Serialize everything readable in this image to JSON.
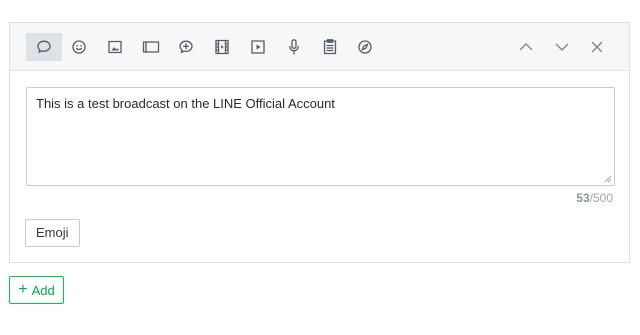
{
  "toolbar": {
    "tools": [
      {
        "icon": "speech-bubble-icon",
        "active": true
      },
      {
        "icon": "smiley-sticker-icon",
        "active": false
      },
      {
        "icon": "image-icon",
        "active": false
      },
      {
        "icon": "card-message-icon",
        "active": false
      },
      {
        "icon": "coupon-icon",
        "active": false
      },
      {
        "icon": "video-film-icon",
        "active": false
      },
      {
        "icon": "play-video-icon",
        "active": false
      },
      {
        "icon": "microphone-icon",
        "active": false
      },
      {
        "icon": "survey-icon",
        "active": false
      },
      {
        "icon": "compass-icon",
        "active": false
      }
    ],
    "controls": [
      "chevron-up-icon",
      "chevron-down-icon",
      "close-icon"
    ]
  },
  "editor": {
    "text": "This is a test broadcast on the LINE Official Account",
    "char_count": "53",
    "char_limit": "/500"
  },
  "emoji_button": {
    "label": "Emoji"
  },
  "add_button": {
    "plus": "+",
    "label": "Add"
  },
  "colors": {
    "accent_green": "#06c755",
    "toolbar_bg": "#f6f7f8",
    "active_tool_bg": "#dde2e7"
  }
}
